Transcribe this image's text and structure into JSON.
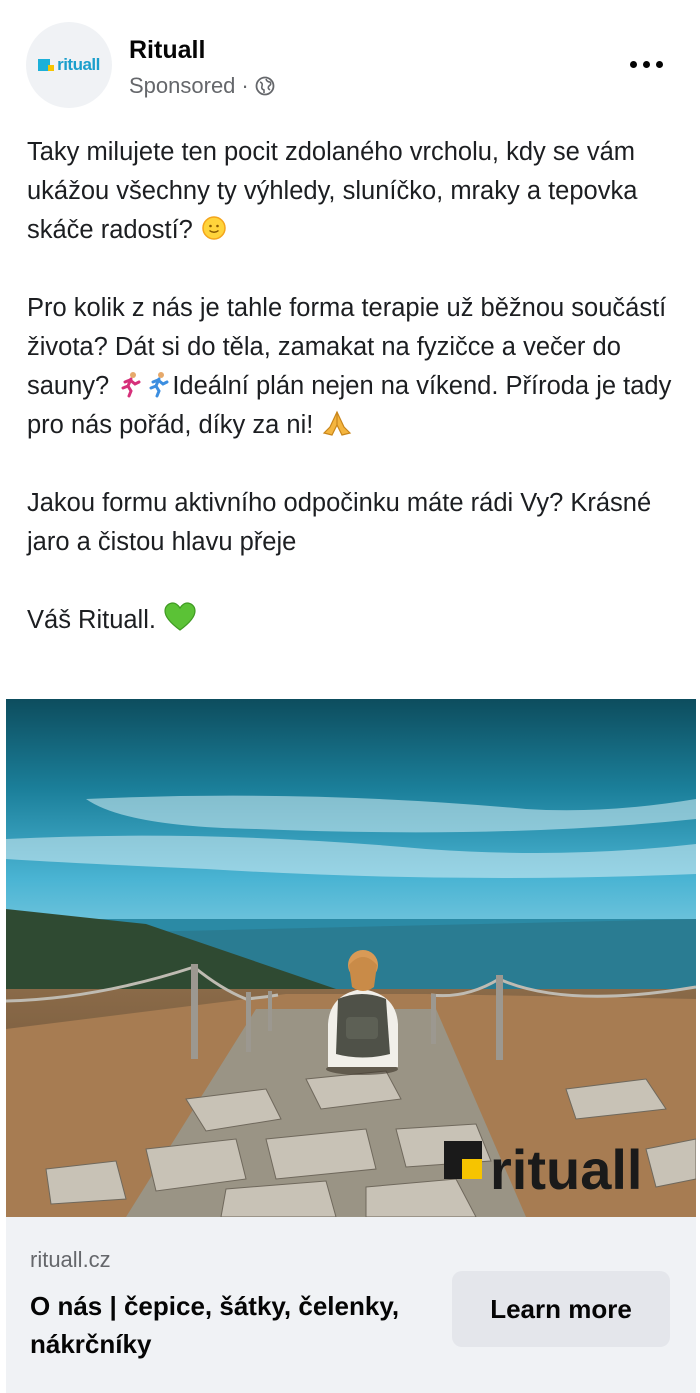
{
  "post": {
    "page_name": "Rituall",
    "sponsored_label": "Sponsored",
    "separator": "·",
    "avatar_logo_text": "rituall",
    "body": {
      "p1": "Taky milujete ten pocit zdolaného vrcholu, kdy se vám ukážou všechny ty výhledy, sluníčko, mraky a tepovka skáče radostí?",
      "p2a": "Pro kolik z nás je tahle forma terapie už běžnou součástí života? Dát si do těla, zamakat na fyzičce a večer do sauny?",
      "p2b": "Ideální plán nejen na víkend. Příroda je tady pro nás pořád, díky za ni!",
      "p3": "Jakou formu aktivního odpočinku máte rádi Vy? Krásné jaro a čistou hlavu přeje",
      "p4": "Váš Rituall."
    },
    "emojis": {
      "sun": "sun-face-emoji",
      "runner": "person-running-emoji",
      "pray": "folded-hands-emoji",
      "heart": "green-heart-emoji"
    },
    "image_watermark": "rituall"
  },
  "link": {
    "domain": "rituall.cz",
    "title": "O nás | čepice, šátky, čelenky, nákrčníky",
    "cta_label": "Learn more"
  },
  "colors": {
    "brand_blue": "#1b9fcc",
    "brand_yellow": "#f6c400",
    "heart_green": "#5bc236",
    "footer_bg": "#f0f2f5",
    "button_bg": "#e4e6eb"
  }
}
